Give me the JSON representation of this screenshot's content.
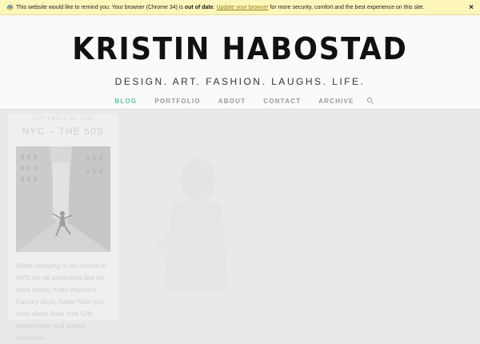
{
  "update_bar": {
    "text_before": "This website would like to remind you: Your browser (Chrome 34) is ",
    "bold_text": "out of date",
    "text_mid": ". ",
    "link_text": "Update your browser",
    "text_after": " for more security, comfort and the best experience on this site.",
    "close_label": "×",
    "icon": "chrome-icon"
  },
  "header": {
    "site_title": "KRISTIN HABOSTAD",
    "tagline": "DESIGN. ART. FASHION. LAUGHS. LIFE."
  },
  "nav": {
    "items": [
      {
        "label": "BLOG",
        "active": true
      },
      {
        "label": "PORTFOLIO",
        "active": false
      },
      {
        "label": "ABOUT",
        "active": false
      },
      {
        "label": "CONTACT",
        "active": false
      },
      {
        "label": "ARCHIVE",
        "active": false
      }
    ],
    "search_icon": "search-icon",
    "active_color": "#5fc3a0"
  },
  "post": {
    "date": "SEPTEMBER 25, 2014",
    "title": "NYC – THE 50S",
    "excerpt": "While studying in art school in NYC we all pretended like we lived during Andy Warhol's Factory days, haha! Now you read about New York City everywhere and almost everyone"
  }
}
